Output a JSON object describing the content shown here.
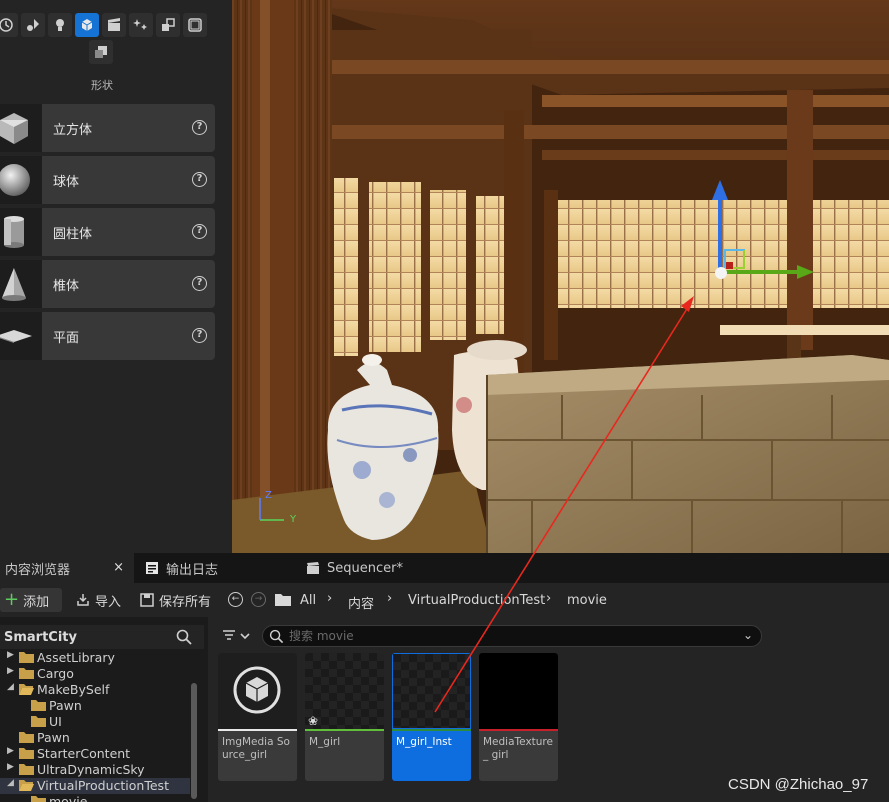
{
  "place_panel": {
    "caption": "形状",
    "mode_icons": [
      "recent-icon",
      "light-actors-icon",
      "lightbulb-icon",
      "shapes-icon",
      "cinematic-icon",
      "visual-effects-icon",
      "volumes-icon",
      "all-classes-icon",
      "geometry-icon"
    ],
    "active_mode": "shapes-icon",
    "shapes": [
      {
        "label": "立方体",
        "icon": "cube-icon"
      },
      {
        "label": "球体",
        "icon": "sphere-icon"
      },
      {
        "label": "圆柱体",
        "icon": "cylinder-icon"
      },
      {
        "label": "椎体",
        "icon": "cone-icon"
      },
      {
        "label": "平面",
        "icon": "plane-icon"
      }
    ]
  },
  "viewport": {
    "axis_labels": {
      "z": "Z",
      "y": "Y"
    }
  },
  "tabs": [
    {
      "label": "内容浏览器",
      "close": "×"
    },
    {
      "label": "输出日志"
    },
    {
      "label": "Sequencer*"
    }
  ],
  "toolbar": {
    "add_label": "添加",
    "import_label": "导入",
    "save_all_label": "保存所有",
    "breadcrumb": [
      "All",
      "内容",
      "VirtualProductionTest",
      "movie"
    ]
  },
  "tree": {
    "title": "SmartCity",
    "items": [
      {
        "label": "AssetLibrary",
        "expanded": false,
        "depth": 0
      },
      {
        "label": "Cargo",
        "expanded": false,
        "depth": 0
      },
      {
        "label": "MakeBySelf",
        "expanded": true,
        "depth": 0
      },
      {
        "label": "Pawn",
        "expanded": null,
        "depth": 1
      },
      {
        "label": "UI",
        "expanded": null,
        "depth": 1
      },
      {
        "label": "Pawn",
        "expanded": null,
        "depth": 0
      },
      {
        "label": "StarterContent",
        "expanded": false,
        "depth": 0
      },
      {
        "label": "UltraDynamicSky",
        "expanded": false,
        "depth": 0
      },
      {
        "label": "VirtualProductionTest",
        "expanded": true,
        "depth": 0
      },
      {
        "label": "movie",
        "expanded": null,
        "depth": 1
      }
    ]
  },
  "assets": {
    "search_placeholder": "搜索 movie",
    "items": [
      {
        "name": "ImgMedia Source_girl",
        "bar_color": "#e8e8e8",
        "selected": false
      },
      {
        "name": "M_girl",
        "bar_color": "#5fbf3a",
        "selected": false
      },
      {
        "name": "M_girl_Inst",
        "bar_color": "#2c8c3a",
        "selected": true
      },
      {
        "name": "MediaTexture_ girl",
        "bar_color": "#c8202a",
        "selected": false
      }
    ]
  },
  "watermark": "CSDN @Zhichao_97",
  "colors": {
    "accent": "#1473d4",
    "selection": "#0e6ee0",
    "annotation_arrow": "#e8281e"
  }
}
